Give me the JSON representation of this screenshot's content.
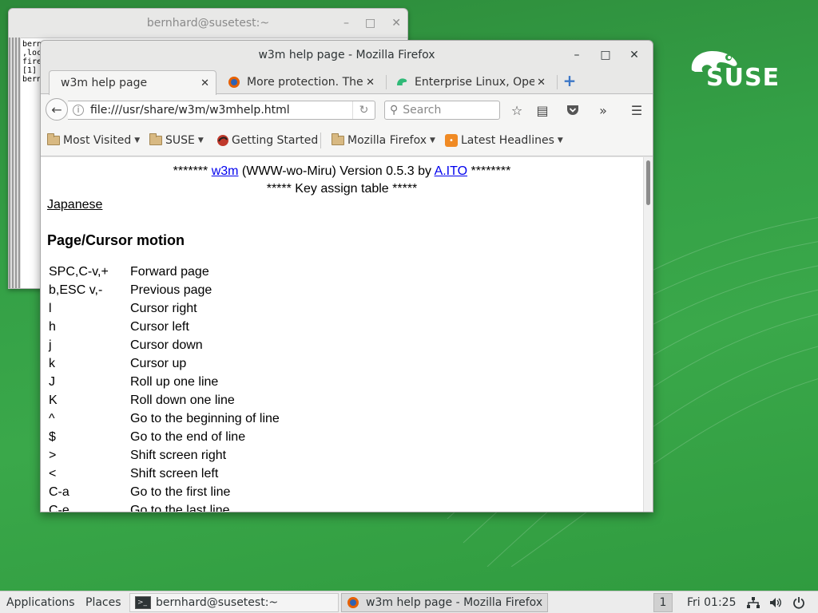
{
  "terminal": {
    "title": "bernhard@susetest:~",
    "lines": [
      "bern",
      ",loc",
      "fire",
      "[1]",
      "bern"
    ]
  },
  "firefox": {
    "title": "w3m help page - Mozilla Firefox",
    "tabs": [
      {
        "label": "w3m help page",
        "active": true
      },
      {
        "label": "More protection. The ...",
        "active": false
      },
      {
        "label": "Enterprise Linux, Ope...",
        "active": false
      }
    ],
    "url": "file:///usr/share/w3m/w3mhelp.html",
    "search_placeholder": "Search",
    "bookmarks": [
      {
        "label": "Most Visited",
        "icon": "folder-icon"
      },
      {
        "label": "SUSE",
        "icon": "folder-icon"
      },
      {
        "label": "Getting Started",
        "icon": "firefox-icon"
      },
      {
        "label": "Mozilla Firefox",
        "icon": "folder-icon"
      },
      {
        "label": "Latest Headlines",
        "icon": "rss-icon"
      }
    ],
    "page": {
      "header_prefix": "******* ",
      "header_link": "w3m",
      "header_mid": " (WWW-wo-Miru) Version 0.5.3 by ",
      "header_author": "A.ITO",
      "header_suffix": " ********",
      "subheader": "***** Key assign table *****",
      "japanese_link": "Japanese",
      "section_title": "Page/Cursor motion",
      "rows": [
        {
          "key": "SPC,C-v,+",
          "desc": "Forward page"
        },
        {
          "key": "b,ESC v,-",
          "desc": "Previous page"
        },
        {
          "key": "l",
          "desc": "Cursor right"
        },
        {
          "key": "h",
          "desc": "Cursor left"
        },
        {
          "key": "j",
          "desc": "Cursor down"
        },
        {
          "key": "k",
          "desc": "Cursor up"
        },
        {
          "key": "J",
          "desc": "Roll up one line"
        },
        {
          "key": "K",
          "desc": "Roll down one line"
        },
        {
          "key": "^",
          "desc": "Go to the beginning of line"
        },
        {
          "key": "$",
          "desc": "Go to the end of line"
        },
        {
          "key": ">",
          "desc": "Shift screen right"
        },
        {
          "key": "<",
          "desc": "Shift screen left"
        },
        {
          "key": "C-a",
          "desc": "Go to the first line"
        },
        {
          "key": "C-e",
          "desc": "Go to the last line"
        }
      ]
    }
  },
  "brand": {
    "logo_text": "SUSE"
  },
  "taskbar": {
    "applications": "Applications",
    "places": "Places",
    "windows": [
      {
        "label": "bernhard@susetest:~",
        "active": false
      },
      {
        "label": "w3m help page - Mozilla Firefox",
        "active": true
      }
    ],
    "workspace": "1",
    "clock": "Fri 01:25"
  },
  "colors": {
    "desktop_green": "#34a046",
    "link_blue": "#0000ee"
  }
}
